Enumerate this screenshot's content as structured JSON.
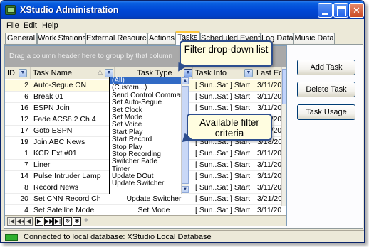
{
  "window": {
    "title": "XStudio Administration",
    "controls": [
      "_",
      "□",
      "×"
    ]
  },
  "menu": [
    "File",
    "Edit",
    "Help"
  ],
  "tabs": [
    "General",
    "Work Stations",
    "External Resources",
    "Actions",
    "Tasks",
    "Scheduled Events",
    "Log Data",
    "Music Data"
  ],
  "active_tab": "Tasks",
  "grid": {
    "group_hint": "Drag a column header here to group by that column",
    "headers": {
      "id": "ID",
      "name": "Task Name",
      "type": "Task Type",
      "info": "Task Info",
      "date": "Last Edi"
    },
    "rows": [
      {
        "id": "2",
        "name": "Auto-Segue ON",
        "type": "",
        "info": "[ Sun..Sat ] Start",
        "date": "3/11/20"
      },
      {
        "id": "6",
        "name": "Break 01",
        "type": "",
        "info": "[ Sun..Sat ] Start",
        "date": "3/11/20"
      },
      {
        "id": "16",
        "name": "ESPN Join",
        "type": "",
        "info": "[ Sun..Sat ] Start",
        "date": "3/11/20"
      },
      {
        "id": "12",
        "name": "Fade ACS8.2 Ch 4",
        "type": "",
        "info": "[ Sun..Sat ] Start",
        "date": "3/11/20"
      },
      {
        "id": "17",
        "name": "Goto ESPN",
        "type": "",
        "info": "[ Sun..Sat ] Start",
        "date": "3/11/20"
      },
      {
        "id": "19",
        "name": "Join ABC News",
        "type": "",
        "info": "[ Sun..Sat ] Start",
        "date": "3/18/20"
      },
      {
        "id": "1",
        "name": "KCR Ext #01",
        "type": "",
        "info": "[ Sun..Sat ] Start",
        "date": "3/11/20"
      },
      {
        "id": "7",
        "name": "Liner",
        "type": "",
        "info": "[ Sun..Sat ] Start",
        "date": "3/11/20"
      },
      {
        "id": "14",
        "name": "Pulse Intruder Lamp",
        "type": "",
        "info": "[ Sun..Sat ] Start",
        "date": "3/11/20"
      },
      {
        "id": "8",
        "name": "Record News",
        "type": "",
        "info": "[ Sun..Sat ] Start",
        "date": "3/11/20"
      },
      {
        "id": "20",
        "name": "Set CNN Record Ch",
        "type": "Update Switcher",
        "info": "[ Sun..Sat ] Start",
        "date": "3/21/20"
      },
      {
        "id": "4",
        "name": "Set Satellite Mode",
        "type": "Set Mode",
        "info": "[ Sun..Sat ] Start",
        "date": "3/11/20"
      }
    ],
    "nav_buttons": [
      "|◀",
      "◀◀",
      "◀",
      "▶",
      "▶▶",
      "▶|",
      "↻",
      "✱",
      "✱"
    ]
  },
  "filter_dropdown": {
    "options": [
      "(All)",
      "(Custom...)",
      "Send Control Command",
      "Set Auto-Segue",
      "Set Clock",
      "Set Mode",
      "Set Voice",
      "Start Play",
      "Start Record",
      "Stop Play",
      "Stop Recording",
      "Switcher Fade",
      "Timer",
      "Update DOut",
      "Update Switcher"
    ],
    "selected": "(All)"
  },
  "callouts": {
    "filter_dropdown_note": "Filter drop-down list",
    "criteria_note": "Available filter criteria"
  },
  "buttons": {
    "add_task": "Add Task",
    "delete_task": "Delete Task",
    "task_usage": "Task Usage"
  },
  "status": {
    "text": "Connected to local database: XStudio Local Database",
    "led_color": "#2fb02f"
  },
  "colors": {
    "titlebar": "#0048d6",
    "active_tab_accent": "#ffc83c",
    "selection": "#316ac5",
    "callout_bg": "#fffde0",
    "callout_border": "#2d4e8e"
  }
}
